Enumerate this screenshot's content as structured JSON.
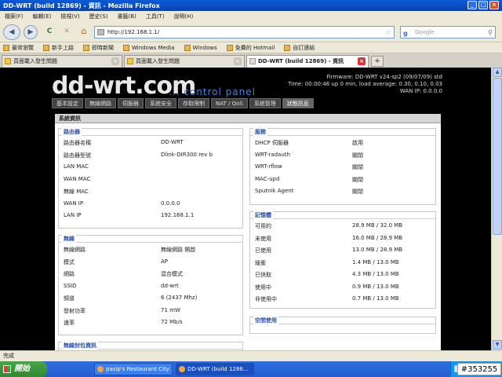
{
  "window": {
    "title": "DD-WRT (build 12869) - 資訊 - Mozilla Firefox",
    "controls": {
      "minimize": "_",
      "maximize": "□",
      "close": "×"
    }
  },
  "menubar": [
    "檔案(F)",
    "編輯(E)",
    "檢視(V)",
    "歷史(S)",
    "書籤(B)",
    "工具(T)",
    "說明(H)"
  ],
  "nav": {
    "back": "◀",
    "forward": "▶",
    "reload": "C",
    "stop": "✕",
    "home": "⌂",
    "url": "http://192.168.1.1/",
    "star": "☆",
    "search_engine": "g",
    "search_placeholder": "Google",
    "search_icon": "⚲"
  },
  "bookmarks": [
    "最常瀏覽",
    "新手上路",
    "即時新聞",
    "Windows Media",
    "Windows",
    "免費的 Hotmail",
    "自訂連結"
  ],
  "tabs": [
    {
      "label": "頁面載入發生問題",
      "active": false
    },
    {
      "label": "頁面載入發生問題",
      "active": false
    },
    {
      "label": "DD-WRT (build 12869) - 資訊",
      "active": true
    }
  ],
  "tab_close": "×",
  "new_tab": "+",
  "scroll": {
    "up": "▲",
    "down": "▼"
  },
  "ddwrt": {
    "logo": "dd-wrt.com",
    "subtitle": "... control panel",
    "firmware": "Firmware: DD-WRT v24-sp2 (09/07/09) std",
    "time": "Time: 00:00:46 up 0 min, load average: 0.30, 0.10, 0.03",
    "wan_ip": "WAN IP: 0.0.0.0",
    "nav": [
      "基本設定",
      "無線網路",
      "伺服器",
      "系統安全",
      "存取限制",
      "NAT / QoS",
      "系統管理",
      "狀態訊息"
    ],
    "active_nav": 7,
    "page_title": "系統資訊",
    "router": {
      "legend": "路由器",
      "rows": [
        {
          "k": "路由器名稱",
          "v": "DD-WRT"
        },
        {
          "k": "路由器型號",
          "v": "Dlink-DIR300 rev b"
        },
        {
          "k": "LAN MAC",
          "v": ""
        },
        {
          "k": "WAN MAC",
          "v": ""
        },
        {
          "k": "無線 MAC",
          "v": ""
        },
        {
          "k": "WAN IP",
          "v": "0.0.0.0"
        },
        {
          "k": "LAN IP",
          "v": "192.168.1.1"
        }
      ]
    },
    "services": {
      "legend": "服務",
      "rows": [
        {
          "k": "DHCP 伺服器",
          "v": "啟用"
        },
        {
          "k": "WRT-radauth",
          "v": "關閉"
        },
        {
          "k": "WRT-rflow",
          "v": "關閉"
        },
        {
          "k": "MAC-upd",
          "v": "關閉"
        },
        {
          "k": "Sputnik Agent",
          "v": "關閉"
        }
      ]
    },
    "wireless": {
      "legend": "無線",
      "rows": [
        {
          "k": "無線網路",
          "v": "無線網路 開啟"
        },
        {
          "k": "模式",
          "v": "AP"
        },
        {
          "k": "網路",
          "v": "混合模式"
        },
        {
          "k": "SSID",
          "v": "dd-wrt"
        },
        {
          "k": "頻道",
          "v": "6 (2437 Mhz)"
        },
        {
          "k": "發射功率",
          "v": "71 mW"
        },
        {
          "k": "速率",
          "v": "72 Mb/s"
        }
      ]
    },
    "memory": {
      "legend": "記憶體",
      "rows": [
        {
          "k": "可用的",
          "v": "28.9 MB / 32.0 MB"
        },
        {
          "k": "未使用",
          "v": "16.0 MB / 28.9 MB"
        },
        {
          "k": "已使用",
          "v": "13.0 MB / 28.9 MB"
        },
        {
          "k": "緩衝",
          "v": "1.4 MB / 13.0 MB"
        },
        {
          "k": "已快取",
          "v": "4.3 MB / 13.0 MB"
        },
        {
          "k": "使用中",
          "v": "0.9 MB / 13.0 MB"
        },
        {
          "k": "非使用中",
          "v": "0.7 MB / 13.0 MB"
        }
      ]
    },
    "space": {
      "legend": "空間使用"
    },
    "wireless_packets": {
      "legend": "無線封包資訊"
    }
  },
  "statusbar": "完成",
  "taskbar": {
    "start": "開始",
    "tasks": [
      {
        "label": "pasip's Restaurant City ...",
        "active": false
      },
      {
        "label": "DD-WRT (build 1286...",
        "active": true
      }
    ],
    "watermark": "#353255"
  }
}
